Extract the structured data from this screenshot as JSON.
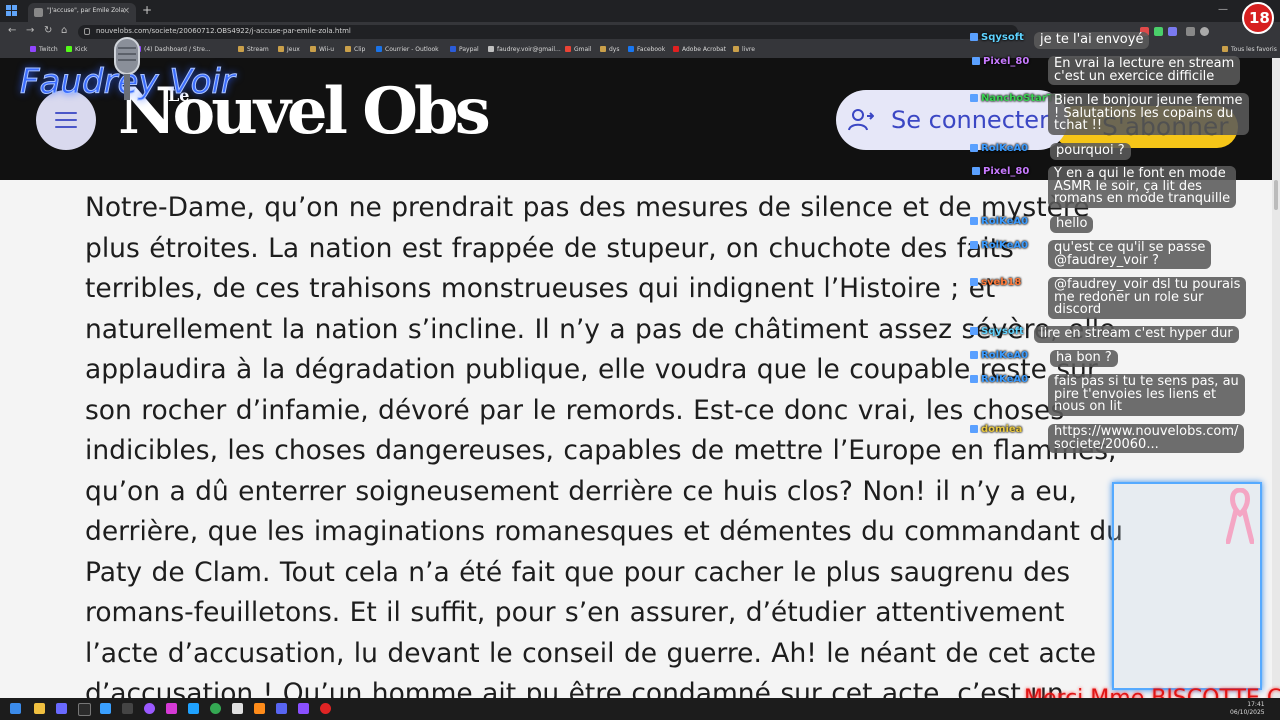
{
  "browser": {
    "tab_title": "\"J'accuse\", par Emile Zola",
    "tab_close": "×",
    "new_tab": "+",
    "url": "nouvelobs.com/societe/20060712.OBS4922/j-accuse-par-emile-zola.html",
    "nav": {
      "back": "←",
      "forward": "→",
      "reload": "↻",
      "home": "⌂"
    },
    "window_controls": {
      "minimize": "—",
      "maximize": "☐",
      "close": "✕"
    },
    "bookmarks": [
      "Twitch",
      "Kick",
      "(4) Dashboard / Stre...",
      "Stream",
      "Jeux",
      "Wii-u",
      "Clip",
      "Courrier - Outlook",
      "Paypal",
      "faudrey.voir@gmail...",
      "Gmail",
      "dys",
      "Facebook",
      "Adobe Acrobat",
      "livre"
    ],
    "all_bookmarks": "Tous les favoris"
  },
  "site": {
    "logo_prefix": "Le",
    "logo": "Nouvel Obs",
    "login_label": "Se connecter",
    "subscribe_label": "S'abonner"
  },
  "article": {
    "lines": [
      "Notre-Dame, qu’on ne prendrait pas des mesures de silence et de mystère",
      "plus étroites. La nation est frappée de stupeur, on chuchote des faits",
      "terribles, de ces trahisons monstrueuses qui indignent l’Histoire ; et",
      "naturellement la nation s’incline. Il n’y a pas de châtiment assez sévère, elle",
      "applaudira à la dégradation publique, elle voudra que le coupable reste sur",
      "son rocher d’infamie, dévoré par le remords. Est-ce donc vrai, les choses",
      "indicibles, les choses dangereuses, capables de mettre l’Europe en flammes,",
      "qu’on a dû enterrer soigneusement derrière ce huis clos? Non! il n’y a eu,",
      "derrière, que les imaginations romanesques et démentes du commandant du",
      "Paty de Clam. Tout cela n’a été fait que pour cacher le plus saugrenu des",
      "romans-feuilletons. Et il suffit, pour s’en assurer, d’étudier attentivement",
      "l’acte d’accusation, lu devant le conseil de guerre. Ah! le néant de cet acte",
      "d’accusation ! Qu’un homme ait pu être condamné sur cet acte, c’est un"
    ]
  },
  "overlay": {
    "streamer_logo": "Faudrey Voir",
    "age_badge": "18",
    "thanks": "Merci Mme BISCOTTE CE"
  },
  "chat": {
    "usernames": [
      "Sqysoft",
      "Pixel_80",
      "NanchoStarTV",
      "RolKeA0",
      "Pixel_80",
      "RolKeA0",
      "RolKeA0",
      "sveb18",
      "Sqysoft",
      "RolKeA0",
      "RolKeA0",
      "domiea"
    ],
    "messages": [
      "je te l'ai envoyé",
      "En vrai la lecture en stream\nc'est un exercice difficile",
      "Bien le bonjour jeune femme\n! Salutations les copains du\ntchat !!",
      "pourquoi ?",
      "Y en a qui le font en mode\nASMR le soir, ça lit des\nromans en mode tranquille",
      "hello",
      "qu'est ce qu'il se passe\n@faudrey_voir ?",
      "@faudrey_voir dsl tu pourais\nme redoner un role sur\ndiscord",
      "lire en stream c'est hyper dur",
      "ha bon ?",
      "fais pas si tu te sens pas, au\npire t'envoies les liens et\nnous on lit",
      "https://www.nouvelobs.com/\nsociete/20060..."
    ]
  },
  "taskbar": {
    "time": "17:41",
    "date": "06/10/2025"
  }
}
